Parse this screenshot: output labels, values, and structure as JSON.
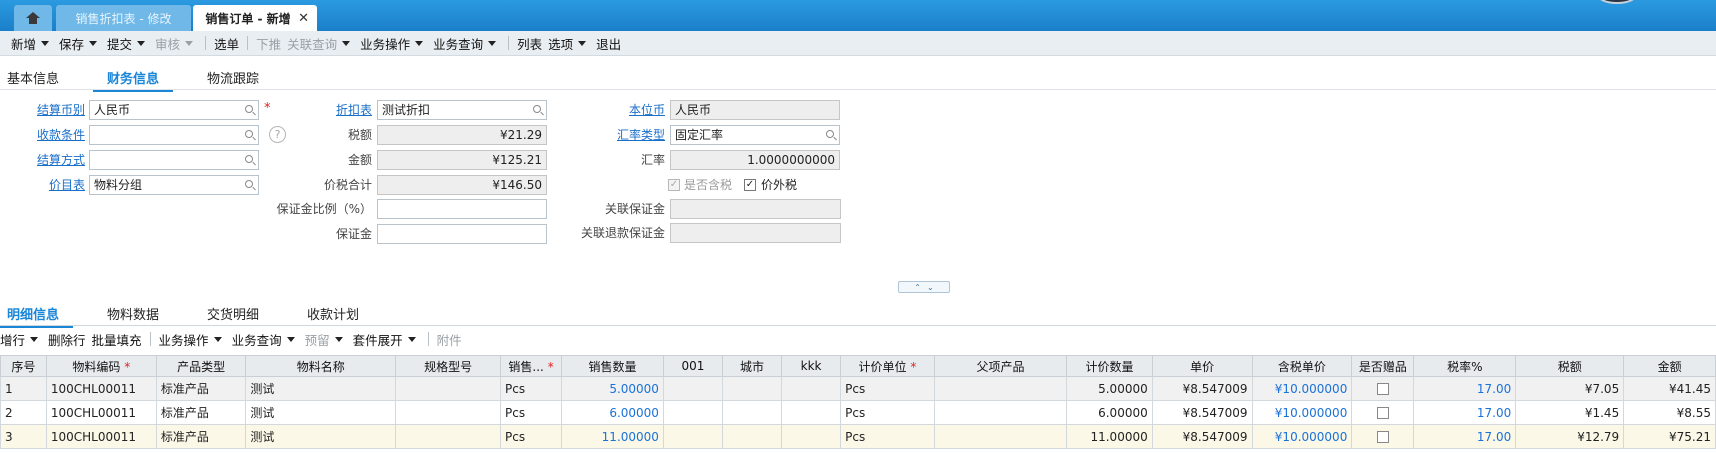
{
  "tabs": {
    "home_icon": "home-icon",
    "items": [
      {
        "label": "销售折扣表 - 修改"
      },
      {
        "label": "销售订单 - 新增",
        "close": "✕"
      }
    ]
  },
  "toolbar": {
    "new": "新增",
    "save": "保存",
    "submit": "提交",
    "audit": "审核",
    "select_order": "选单",
    "push_down": "下推",
    "linked_query": "关联查询",
    "business_ops": "业务操作",
    "business_query": "业务查询",
    "list": "列表",
    "options": "选项",
    "exit": "退出"
  },
  "section_tabs": [
    "基本信息",
    "财务信息",
    "物流跟踪"
  ],
  "form": {
    "settle_currency": {
      "label": "结算币别",
      "value": "人民币"
    },
    "collection_terms": {
      "label": "收款条件",
      "value": ""
    },
    "settle_method": {
      "label": "结算方式",
      "value": ""
    },
    "price_list": {
      "label": "价目表",
      "value": "物料分组"
    },
    "discount_list": {
      "label": "折扣表",
      "value": "测试折扣"
    },
    "tax_amount": {
      "label": "税额",
      "value": "¥21.29"
    },
    "amount": {
      "label": "金额",
      "value": "¥125.21"
    },
    "total_with_tax": {
      "label": "价税合计",
      "value": "¥146.50"
    },
    "deposit_ratio": {
      "label": "保证金比例（%）",
      "value": ""
    },
    "deposit": {
      "label": "保证金",
      "value": ""
    },
    "local_currency": {
      "label": "本位币",
      "value": "人民币"
    },
    "rate_type": {
      "label": "汇率类型",
      "value": "固定汇率"
    },
    "exchange_rate": {
      "label": "汇率",
      "value": "1.0000000000"
    },
    "tax_included": {
      "label": "是否含税",
      "checked": true
    },
    "tax_excluded": {
      "label": "价外税",
      "checked": true
    },
    "linked_deposit": {
      "label": "关联保证金",
      "value": ""
    },
    "linked_refund_deposit": {
      "label": "关联退款保证金",
      "value": ""
    }
  },
  "detail_tabs": [
    "明细信息",
    "物料数据",
    "交货明细",
    "收款计划"
  ],
  "detail_toolbar": {
    "add_row": "增行",
    "delete_row": "删除行",
    "batch_fill": "批量填充",
    "business_ops": "业务操作",
    "business_query": "业务查询",
    "reserve": "预留",
    "kit_expand": "套件展开",
    "attachment": "附件"
  },
  "grid": {
    "columns": [
      "序号",
      "物料编码",
      "产品类型",
      "物料名称",
      "规格型号",
      "销售...",
      "销售数量",
      "001",
      "城市",
      "kkk",
      "计价单位",
      "父项产品",
      "计价数量",
      "单价",
      "含税单价",
      "是否赠品",
      "税率%",
      "税额",
      "金额"
    ],
    "required_columns": [
      1,
      5,
      10
    ],
    "rows": [
      [
        "1",
        "100CHL00011",
        "标准产品",
        "测试",
        "",
        "Pcs",
        "5.00000",
        "",
        "",
        "",
        "Pcs",
        "",
        "5.00000",
        "¥8.547009",
        "¥10.000000",
        "",
        "17.00",
        "¥7.05",
        "¥41.45"
      ],
      [
        "2",
        "100CHL00011",
        "标准产品",
        "测试",
        "",
        "Pcs",
        "6.00000",
        "",
        "",
        "",
        "Pcs",
        "",
        "6.00000",
        "¥8.547009",
        "¥10.000000",
        "",
        "17.00",
        "¥1.45",
        "¥8.55"
      ],
      [
        "3",
        "100CHL00011",
        "标准产品",
        "测试",
        "",
        "Pcs",
        "11.00000",
        "",
        "",
        "",
        "Pcs",
        "",
        "11.00000",
        "¥8.547009",
        "¥10.000000",
        "",
        "17.00",
        "¥12.79",
        "¥75.21"
      ]
    ]
  },
  "colors": {
    "accent": "#1a86d8",
    "link": "#1a6fc9",
    "tabbar": "#1a7fc9",
    "required": "#e02020"
  }
}
